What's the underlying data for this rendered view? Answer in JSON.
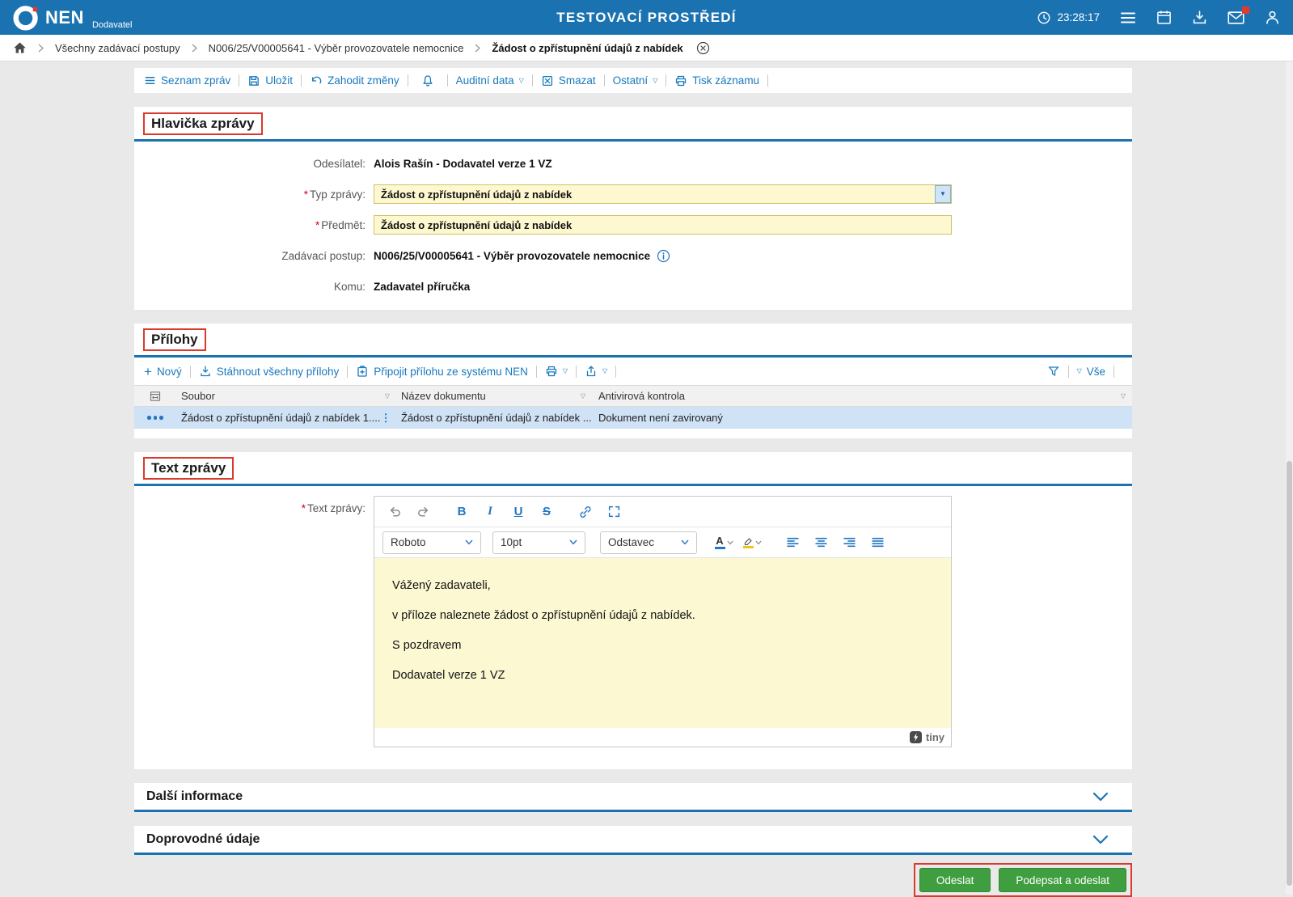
{
  "colors": {
    "header_blue": "#1b72b1",
    "link_blue": "#1879bd",
    "field_yellow": "#fdf8d0",
    "selected_row_blue": "#cfe2f6",
    "button_green": "#3f9e3f",
    "annotation_red": "#d93a2b"
  },
  "icons": {
    "triangle_down_outline": "▽",
    "triangle_down_solid": "▼",
    "kebab_vertical": "⋮",
    "plus": "+",
    "required_star": "*",
    "bold": "B",
    "italic": "I",
    "underline": "U",
    "strikethrough": "S",
    "font_color_letter": "A"
  },
  "header": {
    "logo_text": "NEN",
    "logo_subtitle": "Dodavatel",
    "environment_title": "TESTOVACÍ PROSTŘEDÍ",
    "time": "23:28:17"
  },
  "breadcrumb": {
    "items": [
      "Všechny zadávací postupy",
      "N006/25/V00005641 - Výběr provozovatele nemocnice",
      "Žádost o zpřístupnění údajů z nabídek"
    ]
  },
  "command_bar": {
    "seznam_zprav": "Seznam zpráv",
    "ulozit": "Uložit",
    "zahodit_zmeny": "Zahodit změny",
    "auditni_data": "Auditní data",
    "smazat": "Smazat",
    "ostatni": "Ostatní",
    "tisk_zaznamu": "Tisk záznamu"
  },
  "hlavicka": {
    "title": "Hlavička zprávy",
    "odesilatel": {
      "label": "Odesílatel:",
      "value": "Alois Rašín - Dodavatel verze 1 VZ"
    },
    "typ_zpravy": {
      "label": "Typ zprávy:",
      "value": "Žádost o zpřístupnění údajů z nabídek"
    },
    "predmet": {
      "label": "Předmět:",
      "value": "Žádost o zpřístupnění údajů z nabídek"
    },
    "zadavaci_postup": {
      "label": "Zadávací postup:",
      "value": "N006/25/V00005641 - Výběr provozovatele nemocnice"
    },
    "komu": {
      "label": "Komu:",
      "value": "Zadavatel příručka"
    }
  },
  "prilohy": {
    "title": "Přílohy",
    "toolbar": {
      "novy": "Nový",
      "stahnout_vsechny": "Stáhnout všechny přílohy",
      "pripojit_ze_systemu": "Připojit přílohu ze systému NEN",
      "vse": "Vše"
    },
    "columns": {
      "soubor": "Soubor",
      "nazev_dokumentu": "Název dokumentu",
      "antivirova_kontrola": "Antivirová kontrola"
    },
    "rows": [
      {
        "soubor": "Žádost o zpřístupnění údajů z nabídek 1....",
        "nazev_dokumentu": "Žádost o zpřístupnění údajů z nabídek ...",
        "antivirova_kontrola": "Dokument není zavirovaný"
      }
    ]
  },
  "text_zpravy": {
    "title": "Text zprávy",
    "label": "Text zprávy:",
    "editor": {
      "font_name": "Roboto",
      "font_size": "10pt",
      "block_format": "Odstavec",
      "paragraphs": [
        "Vážený zadavateli,",
        "v příloze naleznete žádost o zpřístupnění údajů z nabídek.",
        "S pozdravem",
        "Dodavatel verze 1 VZ"
      ],
      "brand": "tiny"
    }
  },
  "collapsed_sections": {
    "dalsi_informace": "Další informace",
    "doprovodne_udaje": "Doprovodné údaje"
  },
  "footer_actions": {
    "odeslat": "Odeslat",
    "podepsat_a_odeslat": "Podepsat a odeslat"
  }
}
